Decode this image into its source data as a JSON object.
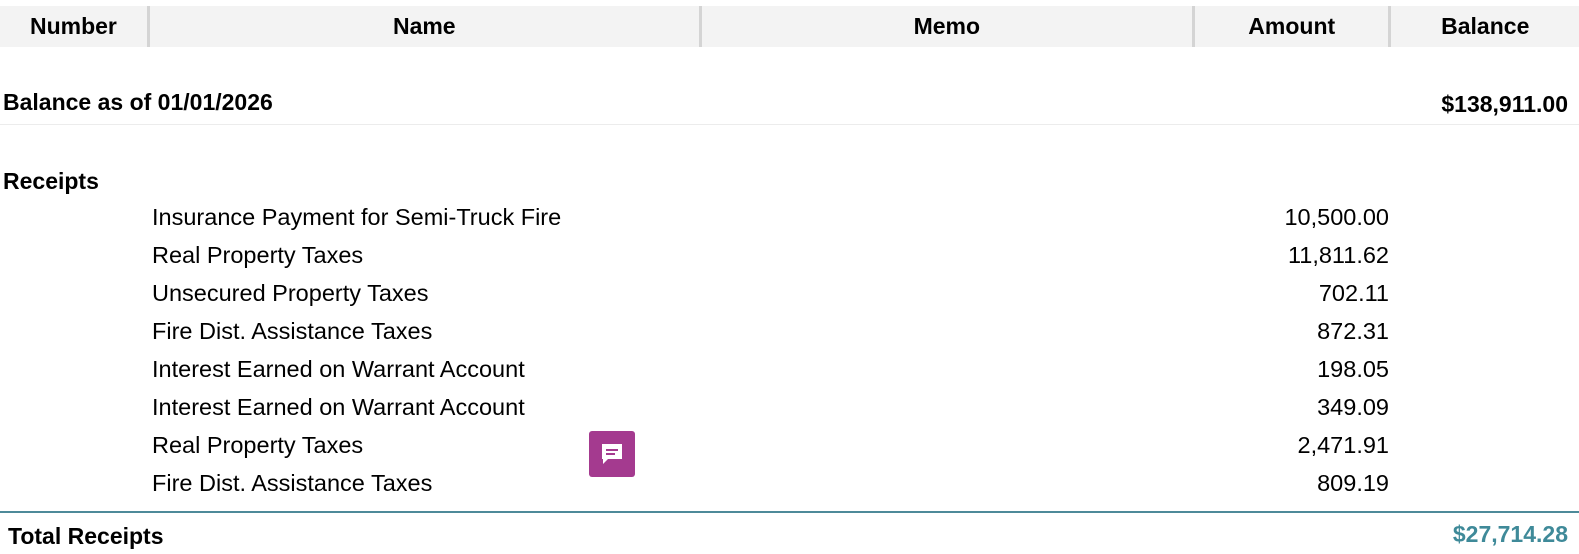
{
  "header": {
    "number": "Number",
    "name": "Name",
    "memo": "Memo",
    "amount": "Amount",
    "balance": "Balance"
  },
  "opening_balance": {
    "label": "Balance as of 01/01/2026",
    "value": "$138,911.00"
  },
  "receipts": {
    "title": "Receipts",
    "rows": [
      {
        "name": "Insurance Payment for Semi-Truck Fire",
        "amount": "10,500.00"
      },
      {
        "name": "Real Property Taxes",
        "amount": "11,811.62"
      },
      {
        "name": "Unsecured Property Taxes",
        "amount": "702.11"
      },
      {
        "name": "Fire Dist. Assistance Taxes",
        "amount": "872.31"
      },
      {
        "name": "Interest Earned on Warrant Account",
        "amount": "198.05"
      },
      {
        "name": "Interest Earned on Warrant Account",
        "amount": "349.09"
      },
      {
        "name": "Real Property Taxes",
        "amount": "2,471.91"
      },
      {
        "name": "Fire Dist. Assistance Taxes",
        "amount": "809.19"
      }
    ],
    "total_label": "Total Receipts",
    "total_value": "$27,714.28"
  },
  "comment_icon": {
    "icon": "comment-icon",
    "color": "#a43a8f"
  },
  "colors": {
    "total_accent": "#3f8a99",
    "header_bg": "#f3f3f3"
  }
}
